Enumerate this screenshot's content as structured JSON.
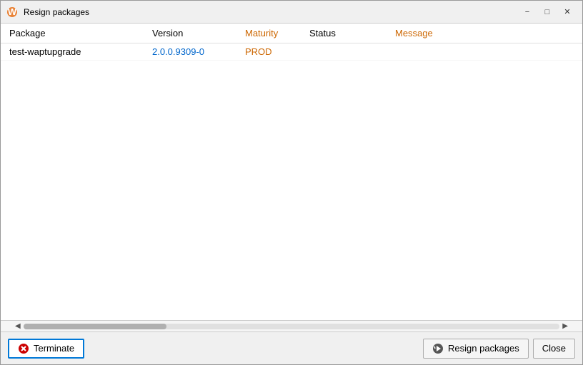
{
  "window": {
    "title": "Resign packages",
    "controls": {
      "minimize": "−",
      "maximize": "□",
      "close": "✕"
    }
  },
  "table": {
    "headers": [
      {
        "key": "package",
        "label": "Package",
        "color": "normal"
      },
      {
        "key": "version",
        "label": "Version",
        "color": "normal"
      },
      {
        "key": "maturity",
        "label": "Maturity",
        "color": "orange"
      },
      {
        "key": "status",
        "label": "Status",
        "color": "normal"
      },
      {
        "key": "message",
        "label": "Message",
        "color": "orange"
      }
    ],
    "rows": [
      {
        "package": "test-waptupgrade",
        "version": "2.0.0.9309-0",
        "maturity": "PROD",
        "status": "",
        "message": ""
      }
    ]
  },
  "footer": {
    "terminate_label": "Terminate",
    "resign_label": "Resign packages",
    "close_label": "Close"
  }
}
